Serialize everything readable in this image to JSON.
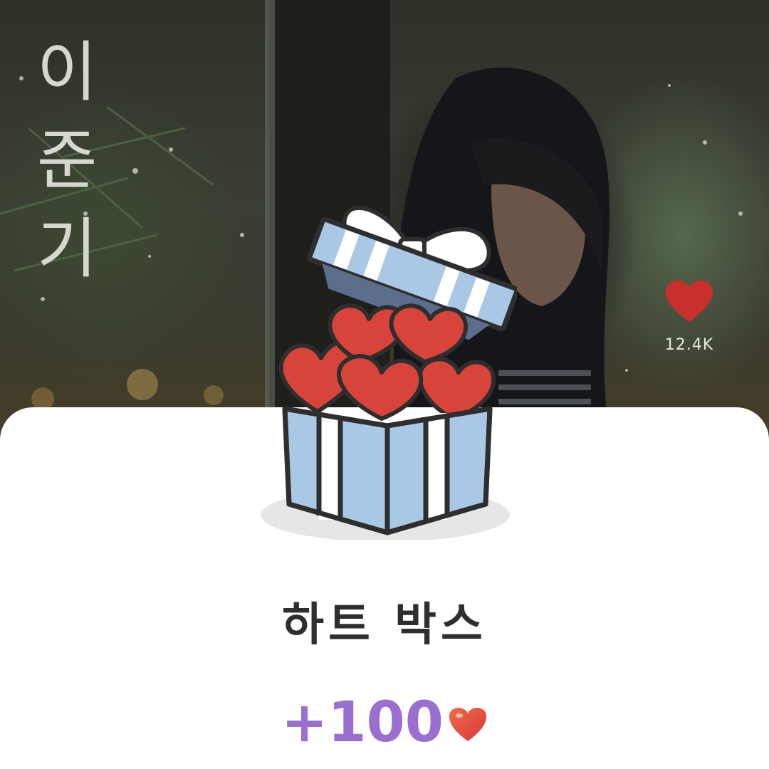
{
  "background": {
    "vertical_title_chars": [
      "이",
      "준",
      "기"
    ]
  },
  "like": {
    "icon": "heart-icon",
    "count": "12.4K",
    "color": "#c9302c"
  },
  "reward": {
    "icon": "gift-box-icon",
    "title": "하트 박스",
    "amount": "+100",
    "amount_icon": "heart-icon",
    "amount_color": "#9b6fcf",
    "heart_color": "#e04a3f",
    "box_color": "#a9c8e6"
  }
}
